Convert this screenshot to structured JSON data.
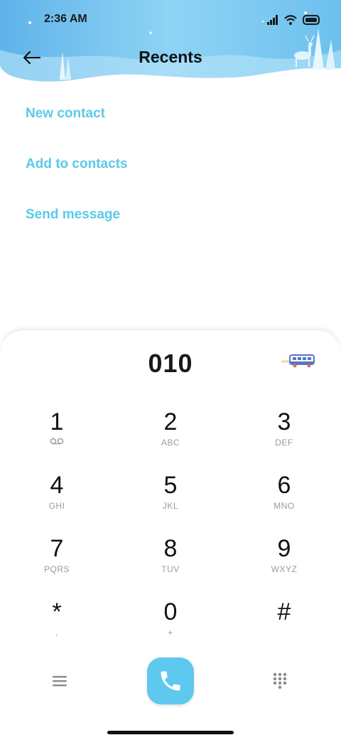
{
  "status_bar": {
    "time": "2:36 AM",
    "icons": [
      "signal-icon",
      "wifi-icon",
      "battery-icon"
    ]
  },
  "header": {
    "title": "Recents",
    "back_icon": "back-arrow-icon",
    "banner_theme": "winter-deer"
  },
  "actions": [
    {
      "label": "New contact"
    },
    {
      "label": "Add to contacts"
    },
    {
      "label": "Send message"
    }
  ],
  "dialer": {
    "number": "010",
    "decoration_icon": "bus-icon",
    "keys": [
      {
        "digit": "1",
        "sub": "",
        "sub_icon": "voicemail-icon"
      },
      {
        "digit": "2",
        "sub": "ABC"
      },
      {
        "digit": "3",
        "sub": "DEF"
      },
      {
        "digit": "4",
        "sub": "GHI"
      },
      {
        "digit": "5",
        "sub": "JKL"
      },
      {
        "digit": "6",
        "sub": "MNO"
      },
      {
        "digit": "7",
        "sub": "PQRS"
      },
      {
        "digit": "8",
        "sub": "TUV"
      },
      {
        "digit": "9",
        "sub": "WXYZ"
      },
      {
        "digit": "*",
        "sub": ","
      },
      {
        "digit": "0",
        "sub": "+"
      },
      {
        "digit": "#",
        "sub": ""
      }
    ],
    "bottom": {
      "menu_icon": "menu-icon",
      "call_icon": "phone-icon",
      "keypad_icon": "keypad-icon"
    }
  },
  "colors": {
    "accent": "#5bc9ea",
    "call_button": "#5ec8ee",
    "banner_sky": "#7cc7ef"
  }
}
